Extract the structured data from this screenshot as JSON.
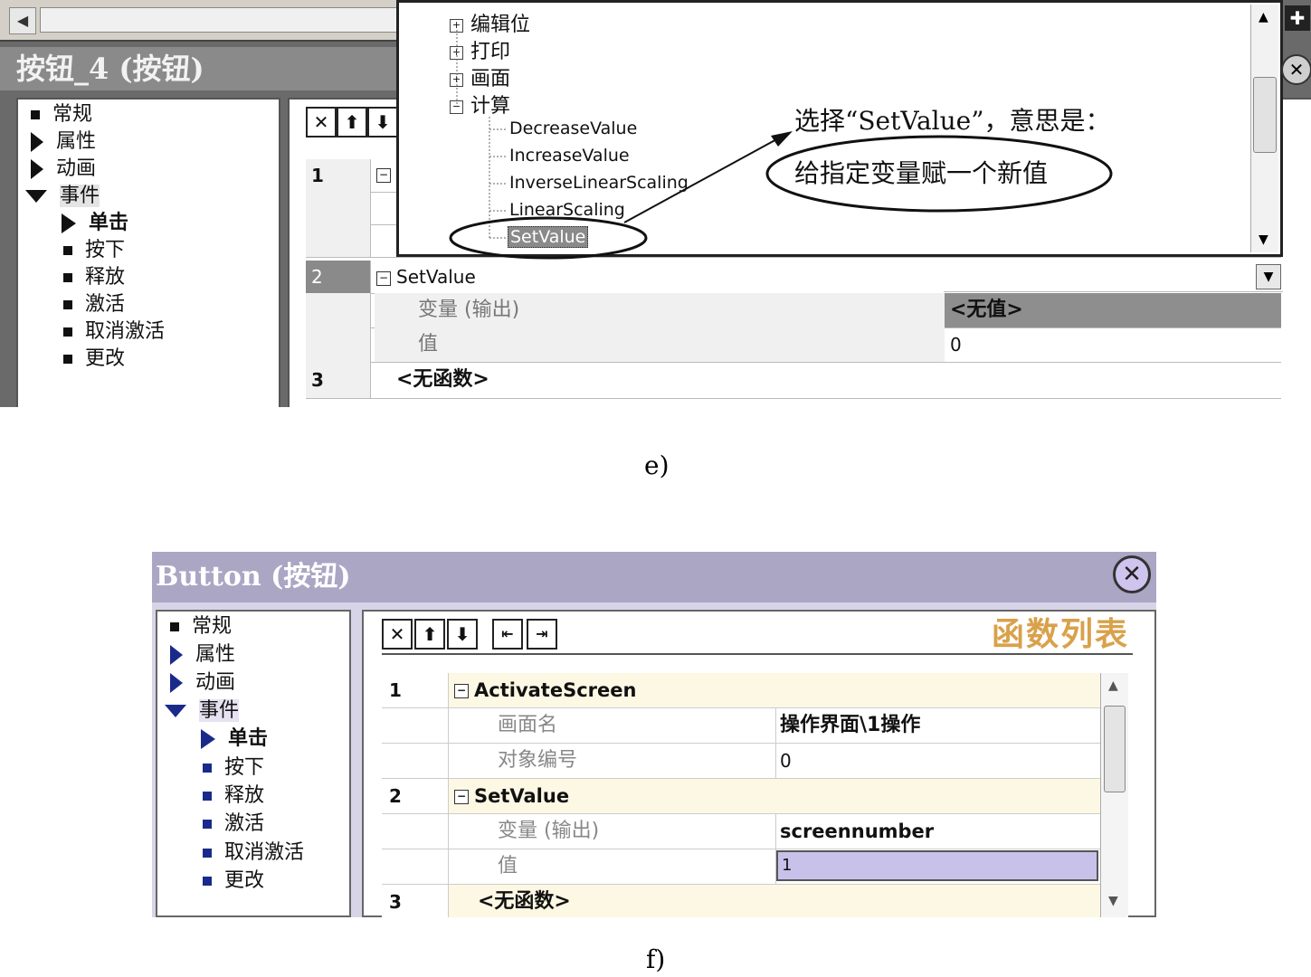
{
  "panel_e": {
    "title": "按钮_4 (按钮)",
    "nav": [
      {
        "label": "常规",
        "kind": "bullet"
      },
      {
        "label": "属性",
        "kind": "collapsed"
      },
      {
        "label": "动画",
        "kind": "collapsed"
      },
      {
        "label": "事件",
        "kind": "expanded"
      },
      {
        "label": "单击",
        "kind": "selected"
      },
      {
        "label": "按下",
        "kind": "bullet"
      },
      {
        "label": "释放",
        "kind": "bullet"
      },
      {
        "label": "激活",
        "kind": "bullet"
      },
      {
        "label": "取消激活",
        "kind": "bullet"
      },
      {
        "label": "更改",
        "kind": "bullet"
      }
    ],
    "toolbar": {
      "delete": "✕",
      "up": "⬆",
      "down": "⬇"
    },
    "rows": {
      "r1_num": "1",
      "r2_num": "2",
      "r2_fn": "SetValue",
      "r2_p1_name": "变量 (输出)",
      "r2_p1_value": "<无值>",
      "r2_p2_name": "值",
      "r2_p2_value": "0",
      "r3_num": "3",
      "r3_fn": "<无函数>"
    },
    "tree": {
      "groups": [
        "编辑位",
        "打印",
        "画面",
        "计算"
      ],
      "leaves": [
        "DecreaseValue",
        "IncreaseValue",
        "InverseLinearScaling",
        "LinearScaling",
        "SetValue"
      ]
    },
    "annotation": {
      "line1": "选择“SetValue”，意思是：",
      "line2": "给指定变量赋一个新值"
    },
    "caption": "e)"
  },
  "panel_f": {
    "title": "Button (按钮)",
    "nav": [
      {
        "label": "常规",
        "kind": "bullet"
      },
      {
        "label": "属性",
        "kind": "collapsed"
      },
      {
        "label": "动画",
        "kind": "collapsed"
      },
      {
        "label": "事件",
        "kind": "expanded"
      },
      {
        "label": "单击",
        "kind": "selected"
      },
      {
        "label": "按下",
        "kind": "bullet"
      },
      {
        "label": "释放",
        "kind": "bullet"
      },
      {
        "label": "激活",
        "kind": "bullet"
      },
      {
        "label": "取消激活",
        "kind": "bullet"
      },
      {
        "label": "更改",
        "kind": "bullet"
      }
    ],
    "heading": "函数列表",
    "rows": {
      "r1_num": "1",
      "r1_fn": "ActivateScreen",
      "r1_p1_name": "画面名",
      "r1_p1_value": "操作界面\\1操作",
      "r1_p2_name": "对象编号",
      "r1_p2_value": "0",
      "r2_num": "2",
      "r2_fn": "SetValue",
      "r2_p1_name": "变量 (输出)",
      "r2_p1_value": "screennumber",
      "r2_p2_name": "值",
      "r2_p2_value": "1",
      "r3_num": "3",
      "r3_fn": "<无函数>"
    },
    "caption": "f)"
  },
  "colors": {
    "accent_heading": "#d9a14a",
    "selection": "#c8c2ea",
    "function_row": "#fdf8e4"
  }
}
